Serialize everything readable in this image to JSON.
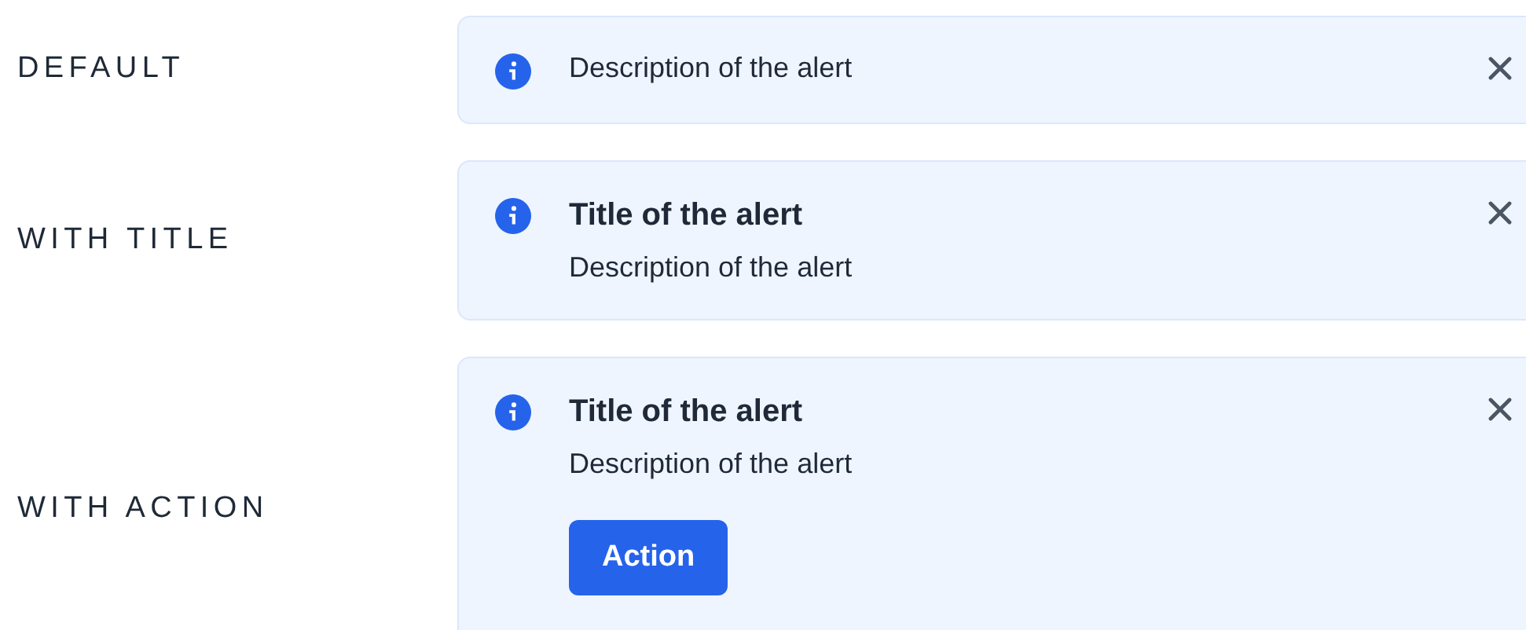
{
  "examples": [
    {
      "label": "DEFAULT",
      "alert": {
        "description": "Description of the alert"
      }
    },
    {
      "label": "WITH TITLE",
      "alert": {
        "title": "Title of the alert",
        "description": "Description of the alert"
      }
    },
    {
      "label": "WITH ACTION",
      "alert": {
        "title": "Title of the alert",
        "description": "Description of the alert",
        "action": "Action"
      }
    }
  ]
}
